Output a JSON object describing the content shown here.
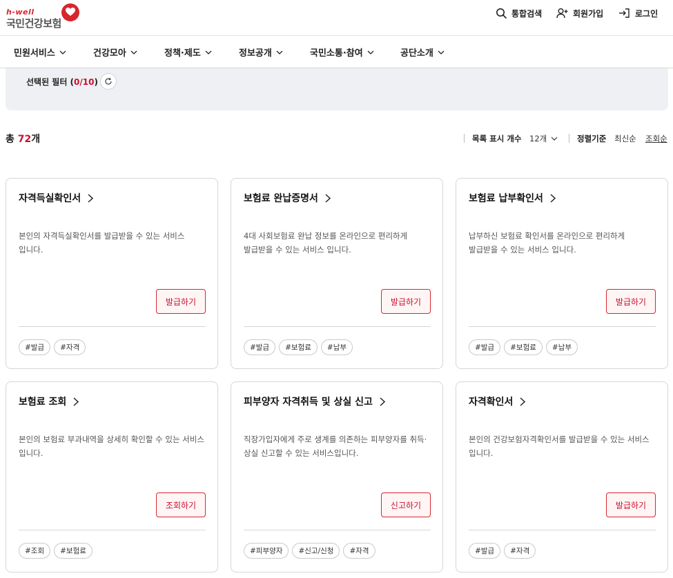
{
  "header": {
    "logo_sub": "h-well",
    "logo_main": "국민건강보험",
    "search_label": "통합검색",
    "join_label": "회원가입",
    "login_label": "로그인"
  },
  "nav": {
    "items": [
      {
        "label": "민원서비스"
      },
      {
        "label": "건강모아"
      },
      {
        "label": "정책·제도"
      },
      {
        "label": "정보공개"
      },
      {
        "label": "국민소통·참여"
      },
      {
        "label": "공단소개"
      }
    ]
  },
  "filter": {
    "label_prefix": "선택된 필터 (",
    "count": "0/10",
    "label_suffix": ")"
  },
  "list": {
    "total_prefix": "총 ",
    "total_count": "72",
    "total_suffix": "개",
    "display_label": "목록 표시 개수",
    "display_value": "12개",
    "sort_label": "정렬기준",
    "sort_latest": "최신순",
    "sort_views": "조회순"
  },
  "cards": [
    {
      "title": "자격득실확인서",
      "desc": "본인의 자격득실확인서를 발급받을 수 있는 서비스 입니다.",
      "button": "발급하기",
      "tags": [
        "#발급",
        "#자격"
      ]
    },
    {
      "title": "보험료 완납증명서",
      "desc": "4대 사회보험료 완납 정보를 온라인으로 편리하게 발급받을 수 있는 서비스 입니다.",
      "button": "발급하기",
      "tags": [
        "#발급",
        "#보험료",
        "#납부"
      ]
    },
    {
      "title": "보험료 납부확인서",
      "desc": "납부하신 보험료 확인서를 온라인으로 편리하게 발급받을 수 있는 서비스 입니다.",
      "button": "발급하기",
      "tags": [
        "#발급",
        "#보험료",
        "#납부"
      ]
    },
    {
      "title": "보험료 조회",
      "desc": "본인의 보험료 부과내역을 상세히 확인할 수 있는 서비스 입니다.",
      "button": "조회하기",
      "tags": [
        "#조회",
        "#보험료"
      ]
    },
    {
      "title": "피부양자 자격취득 및 상실 신고",
      "desc": "직장가입자에게 주로 생계를 의존하는 피부양자를 취득·상실 신고할 수 있는 서비스입니다.",
      "button": "신고하기",
      "tags": [
        "#피부양자",
        "#신고/신청",
        "#자격"
      ]
    },
    {
      "title": "자격확인서",
      "desc": "본인의 건강보험자격확인서를 발급받을 수 있는 서비스 입니다.",
      "button": "발급하기",
      "tags": [
        "#발급",
        "#자격"
      ]
    }
  ],
  "colors": {
    "brand": "#d8262e",
    "accent_text": "#c8102e",
    "filter_bg": "#eef0f3"
  }
}
